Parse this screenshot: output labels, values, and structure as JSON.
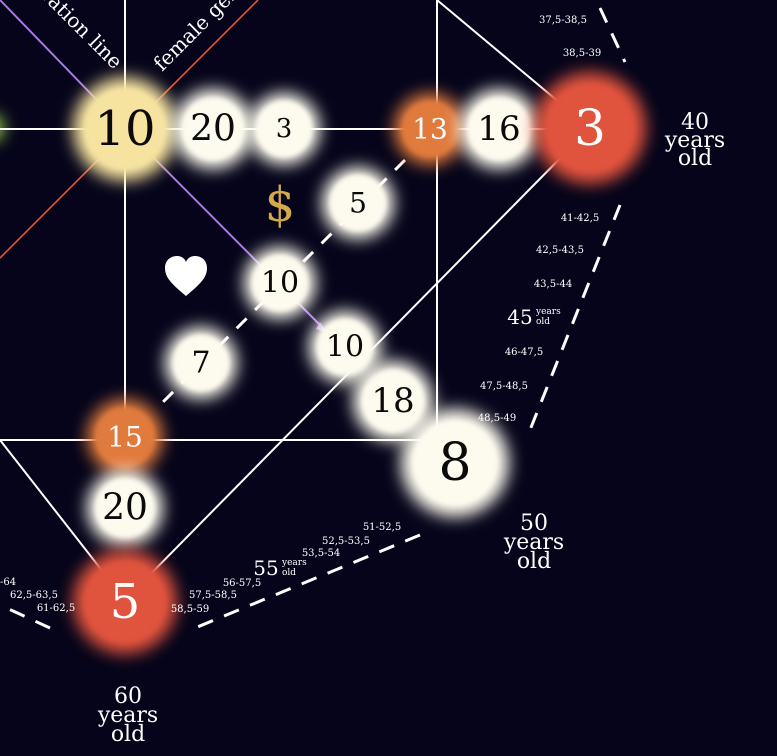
{
  "colors": {
    "background": "#05041a",
    "node_light": "#fdfbee",
    "node_gold": "#f6e3a0",
    "node_orange": "#e07a3e",
    "node_red": "#e0533c",
    "line_white": "#ffffff",
    "line_purple": "#a978e6",
    "line_orange": "#e05a3c",
    "dollar": "#d4a94a",
    "heart": "#ffffff"
  },
  "lines": {
    "generation_label": "ration line",
    "female_label": "female gen"
  },
  "nodes": [
    {
      "value": "10",
      "color": "gold"
    },
    {
      "value": "20",
      "color": "light"
    },
    {
      "value": "3",
      "color": "light"
    },
    {
      "value": "13",
      "color": "orange"
    },
    {
      "value": "16",
      "color": "light"
    },
    {
      "value": "3",
      "color": "red"
    },
    {
      "value": "5",
      "color": "light"
    },
    {
      "value": "10",
      "color": "light"
    },
    {
      "value": "10",
      "color": "light"
    },
    {
      "value": "7",
      "color": "light"
    },
    {
      "value": "18",
      "color": "light"
    },
    {
      "value": "8",
      "color": "light"
    },
    {
      "value": "15",
      "color": "orange"
    },
    {
      "value": "20",
      "color": "light"
    },
    {
      "value": "5",
      "color": "red"
    }
  ],
  "symbols": {
    "dollar": "$",
    "heart": "heart-icon"
  },
  "ages": {
    "age40": [
      "40",
      "years",
      "old"
    ],
    "age50": [
      "50",
      "years",
      "old"
    ],
    "age60": [
      "60",
      "years",
      "old"
    ],
    "age45": {
      "num": "45",
      "l1": "years",
      "l2": "old"
    },
    "age55": {
      "num": "55",
      "l1": "years",
      "l2": "old"
    }
  },
  "ticks": {
    "t1": "37,5-38,5",
    "t2": "38,5-39",
    "t3": "41-42,5",
    "t4": "42,5-43,5",
    "t5": "43,5-44",
    "t6": "46-47,5",
    "t7": "47,5-48,5",
    "t8": "48,5-49",
    "t9": "51-52,5",
    "t10": "52,5-53,5",
    "t11": "53,5-54",
    "t12": "56-57,5",
    "t13": "57,5-58,5",
    "t14": "58,5-59",
    "t15": "-64",
    "t16": "62,5-63,5",
    "t17": "61-62,5"
  }
}
